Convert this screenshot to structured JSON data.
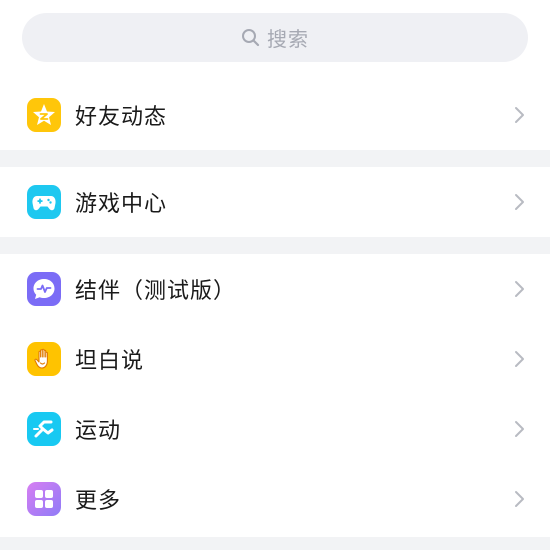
{
  "search": {
    "placeholder": "搜索",
    "icon": "search-icon"
  },
  "groups": [
    {
      "items": [
        {
          "label": "好友动态",
          "icon": "star-icon",
          "color": "#ffc60a"
        }
      ]
    },
    {
      "items": [
        {
          "label": "游戏中心",
          "icon": "gamepad-icon",
          "color": "#1ec8f0"
        }
      ]
    },
    {
      "items": [
        {
          "label": "结伴（测试版）",
          "icon": "pulse-bubble-icon",
          "color": "#7b6cf6"
        },
        {
          "label": "坦白说",
          "icon": "hand-icon",
          "color": "#ffc300"
        },
        {
          "label": "运动",
          "icon": "running-icon",
          "color": "#18c9f2"
        },
        {
          "label": "更多",
          "icon": "grid-icon",
          "color": "#b57cf5"
        }
      ]
    }
  ],
  "colors": {
    "background": "#ffffff",
    "divider": "#f2f3f5",
    "search_bg": "#eff0f4",
    "placeholder": "#a6a9b3",
    "chevron": "#b8bbc2"
  }
}
